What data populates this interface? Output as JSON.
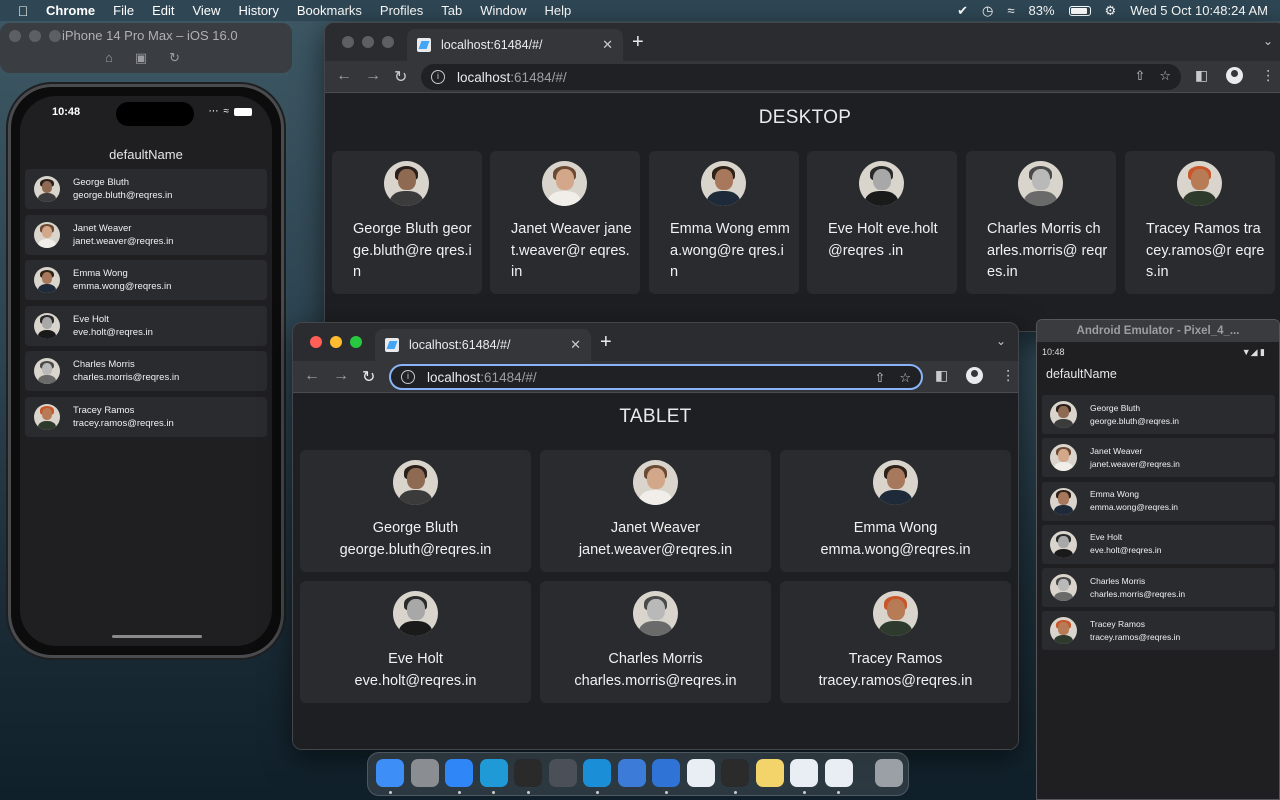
{
  "menubar": {
    "app": "Chrome",
    "items": [
      "File",
      "Edit",
      "View",
      "History",
      "Bookmarks",
      "Profiles",
      "Tab",
      "Window",
      "Help"
    ],
    "battery": "83%",
    "clock": "Wed 5 Oct  10:48:24 AM"
  },
  "simulator": {
    "title": "iPhone 14 Pro Max – iOS 16.0",
    "time": "10:48",
    "app_title": "defaultName"
  },
  "users": [
    {
      "name": "George Bluth",
      "email": "george.bluth@reqres.in",
      "skin": "#8e6a52",
      "hair": "#2a1f1a",
      "shirt": "#3b3b3b"
    },
    {
      "name": "Janet Weaver",
      "email": "janet.weaver@reqres.in",
      "skin": "#d3a789",
      "hair": "#6b4a33",
      "shirt": "#f1ede8"
    },
    {
      "name": "Emma Wong",
      "email": "emma.wong@reqres.in",
      "skin": "#a7785c",
      "hair": "#2e2118",
      "shirt": "#1e2a3a"
    },
    {
      "name": "Eve Holt",
      "email": "eve.holt@reqres.in",
      "skin": "#a8a8a8",
      "hair": "#2a2a2a",
      "shirt": "#1a1a1a"
    },
    {
      "name": "Charles Morris",
      "email": "charles.morris@reqres.in",
      "skin": "#b9b9b9",
      "hair": "#4a4a4a",
      "shirt": "#6a6a6a"
    },
    {
      "name": "Tracey Ramos",
      "email": "tracey.ramos@reqres.in",
      "skin": "#b77b55",
      "hair": "#c9562a",
      "shirt": "#2e3b2c"
    }
  ],
  "desktop_window": {
    "tab_title": "localhost:61484/#/",
    "url_host": "localhost",
    "url_rest": ":61484/#/",
    "heading": "DESKTOP",
    "cards_text": [
      "George Bluth george.bluth@re qres.in",
      "Janet Weaver janet.weaver@r eqres.in",
      "Emma Wong emma.wong@re qres.in",
      "Eve Holt eve.holt@reqres .in",
      "Charles Morris charles.morris@ reqres.in",
      "Tracey Ramos tracey.ramos@r eqres.in"
    ]
  },
  "tablet_window": {
    "tab_title": "localhost:61484/#/",
    "url_host": "localhost",
    "url_rest": ":61484/#/",
    "heading": "TABLET"
  },
  "android": {
    "title": "Android Emulator - Pixel_4_...",
    "time": "10:48",
    "app_title": "defaultName"
  },
  "dock_apps": [
    {
      "name": "finder",
      "color": "#3e8ef7"
    },
    {
      "name": "launchpad",
      "color": "#8a8d92"
    },
    {
      "name": "safari",
      "color": "#2f86f6"
    },
    {
      "name": "edge",
      "color": "#1f9ad7"
    },
    {
      "name": "terminal",
      "color": "#2a2a2a"
    },
    {
      "name": "android-studio-arch",
      "color": "#4b5058"
    },
    {
      "name": "skype",
      "color": "#1a8fd8"
    },
    {
      "name": "xcode",
      "color": "#3d7bd9"
    },
    {
      "name": "xcode-2",
      "color": "#2f73d6"
    },
    {
      "name": "word",
      "color": "#e9eef5"
    },
    {
      "name": "obs",
      "color": "#2b2b2b"
    },
    {
      "name": "notes",
      "color": "#f3d46a"
    },
    {
      "name": "flutter-tool",
      "color": "#e9eef5"
    },
    {
      "name": "chrome",
      "color": "#e9eef5"
    },
    {
      "name": "trash",
      "color": "#9aa0a6"
    }
  ]
}
